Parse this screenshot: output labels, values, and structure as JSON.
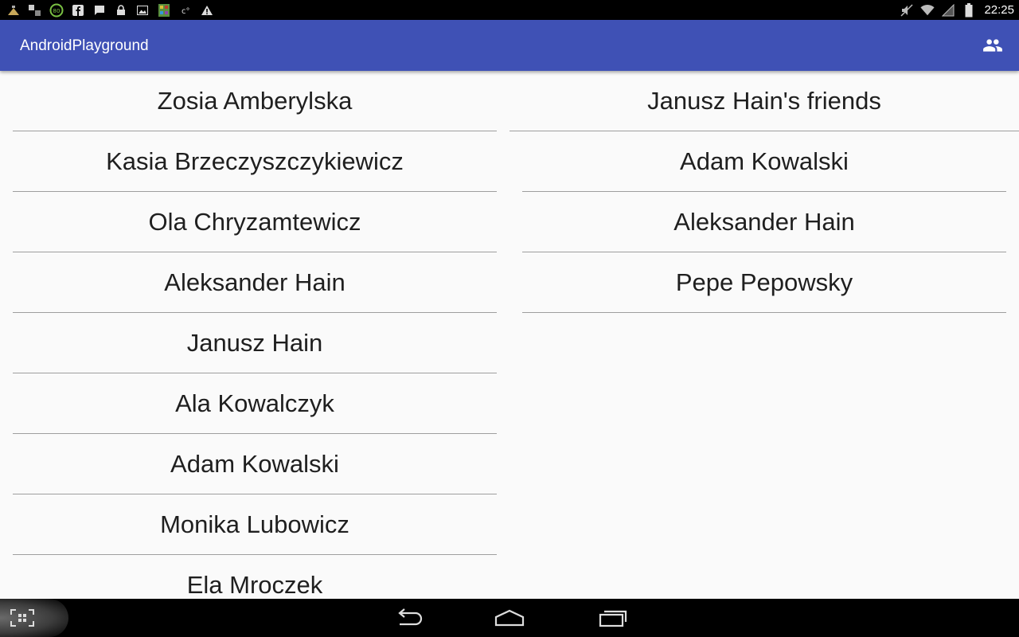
{
  "status_bar": {
    "time": "22:25",
    "notification_icons": [
      "app-icon",
      "notification-icon",
      "circle-badge-icon",
      "facebook-icon",
      "message-icon",
      "lock-icon",
      "image-icon",
      "app-grid-icon",
      "settings-icon",
      "warning-icon"
    ],
    "status_icons": [
      "mute-icon",
      "wifi-icon",
      "signal-icon",
      "battery-icon"
    ]
  },
  "app_bar": {
    "title": "AndroidPlayground",
    "action_icon": "people-icon"
  },
  "people_list": {
    "items": [
      "Zosia Amberylska",
      "Kasia Brzeczyszczykiewicz",
      "Ola Chryzamtewicz",
      "Aleksander Hain",
      "Janusz Hain",
      "Ala Kowalczyk",
      "Adam Kowalski",
      "Monika Lubowicz",
      "Ela Mroczek"
    ]
  },
  "friends_panel": {
    "title": "Janusz Hain's friends",
    "items": [
      "Adam Kowalski",
      "Aleksander Hain",
      "Pepe Pepowsky"
    ]
  },
  "nav_bar": {
    "buttons": [
      "screenshot-icon",
      "back-icon",
      "home-icon",
      "recents-icon"
    ]
  },
  "colors": {
    "primary": "#3f51b5",
    "background": "#fafafa",
    "divider": "#9e9e9e",
    "text": "#1f1f1f"
  }
}
